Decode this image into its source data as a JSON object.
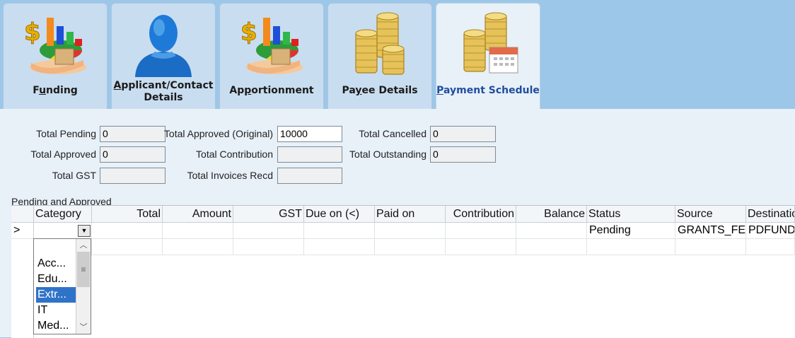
{
  "tabs": [
    {
      "label_pre": "F",
      "label_u": "u",
      "label_post": "nding",
      "icon": "funding-icon",
      "active": false
    },
    {
      "label_pre": "",
      "label_u": "A",
      "label_post": "pplicant/Contact",
      "label_line2": "Details",
      "icon": "person-icon",
      "active": false
    },
    {
      "label_pre": "Ap",
      "label_u": "p",
      "label_post": "ortionment",
      "icon": "apportionment-icon",
      "active": false
    },
    {
      "label_pre": "Pa",
      "label_u": "y",
      "label_post": "ee Details",
      "icon": "coins-icon",
      "active": false
    },
    {
      "label_pre": "",
      "label_u": "P",
      "label_post": "ayment Schedule",
      "icon": "coins-calendar-icon",
      "active": true
    }
  ],
  "summary": {
    "total_pending_label": "Total Pending",
    "total_pending_value": "0",
    "total_approved_label": "Total Approved",
    "total_approved_value": "0",
    "total_gst_label": "Total GST",
    "total_gst_value": "",
    "total_approved_original_label": "Total Approved (Original)",
    "total_approved_original_value": "10000",
    "total_contribution_label": "Total Contribution",
    "total_contribution_value": "",
    "total_invoices_recd_label": "Total Invoices Recd",
    "total_invoices_recd_value": "",
    "total_cancelled_label": "Total Cancelled",
    "total_cancelled_value": "0",
    "total_outstanding_label": "Total Outstanding",
    "total_outstanding_value": "0"
  },
  "grid": {
    "title": "Pending and Approved",
    "columns": [
      "Category",
      "Total",
      "Amount",
      "GST",
      "Due on (<)",
      "Paid on",
      "Contribution",
      "Balance",
      "Status",
      "Source",
      "Destination"
    ],
    "row_marker": ">",
    "rows": [
      {
        "category": "",
        "total": "",
        "amount": "",
        "gst": "",
        "due_on": "",
        "paid_on": "",
        "contribution": "",
        "balance": "",
        "status": "Pending",
        "source": "GRANTS_FE",
        "destination": "PDFUND"
      }
    ]
  },
  "category_dropdown": {
    "options": [
      "Acc...",
      "Edu...",
      "Extr...",
      "IT",
      "Med..."
    ],
    "selected_index": 2
  },
  "colors": {
    "tabbar_bg": "#9cc7e8",
    "panel_bg": "#e8f0f8",
    "active_tab_text": "#1f4d9e",
    "selection": "#2f73c8"
  }
}
